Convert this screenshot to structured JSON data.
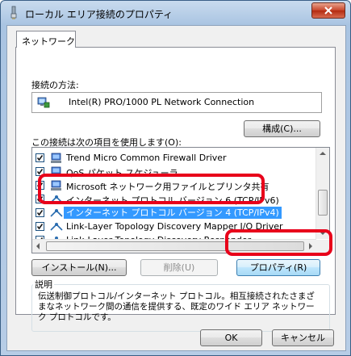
{
  "window": {
    "title": "ローカル エリア接続のプロパティ"
  },
  "tabs": [
    {
      "label": "ネットワーク"
    }
  ],
  "connection": {
    "label": "接続の方法:",
    "adapter": "Intel(R) PRO/1000 PL Network Connection",
    "configure_button": "構成(C)..."
  },
  "items_label": "この接続は次の項目を使用します(O):",
  "items": [
    {
      "label": "Trend Micro Common Firewall Driver",
      "checked": true
    },
    {
      "label": "QoS パケット スケジューラ",
      "checked": true
    },
    {
      "label": "Microsoft ネットワーク用ファイルとプリンタ共有",
      "checked": true
    },
    {
      "label": "インターネット プロトコル バージョン 6 (TCP/IPv6)",
      "checked": true
    },
    {
      "label": "インターネット プロトコル バージョン 4 (TCP/IPv4)",
      "checked": true,
      "selected": true
    },
    {
      "label": "Link-Layer Topology Discovery Mapper I/O Driver",
      "checked": true
    },
    {
      "label": "Link-Layer Topology Discovery Responder",
      "checked": true
    }
  ],
  "buttons": {
    "install": "インストール(N)...",
    "uninstall": "削除(U)",
    "properties": "プロパティ(R)",
    "ok": "OK",
    "cancel": "キャンセル"
  },
  "description": {
    "title": "説明",
    "text": "伝送制御プロトコル/インターネット プロトコル。相互接続されたさまざまなネットワーク間の通信を提供する、既定のワイド エリア ネットワーク プロトコルです。"
  },
  "colors": {
    "highlight": "#e8001a",
    "selection": "#3399ff"
  }
}
